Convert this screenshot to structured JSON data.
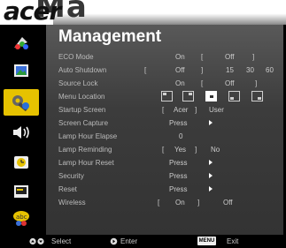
{
  "brand": {
    "logo": "acer",
    "heading_fragment": "Ma"
  },
  "sidebar": {
    "items": [
      {
        "icon": "color-wheel-icon",
        "active": false
      },
      {
        "icon": "image-picture-icon",
        "active": false
      },
      {
        "icon": "settings-management-icon",
        "active": true
      },
      {
        "icon": "speaker-audio-icon",
        "active": false
      },
      {
        "icon": "clock-timer-icon",
        "active": false
      },
      {
        "icon": "screen-display-icon",
        "active": false
      },
      {
        "icon": "language-globe-icon",
        "active": false
      }
    ]
  },
  "panel": {
    "title": "Management",
    "rows": [
      {
        "label": "ECO Mode",
        "values": [
          "On",
          "[",
          "Off",
          "]"
        ]
      },
      {
        "label": "Auto Shutdown",
        "values": [
          "[",
          "Off",
          "]",
          "15",
          "30",
          "60"
        ]
      },
      {
        "label": "Source Lock",
        "values": [
          "On",
          "[",
          "Off",
          "]"
        ]
      },
      {
        "label": "Menu Location"
      },
      {
        "label": "Startup Screen",
        "values": [
          "[",
          "Acer",
          "]",
          "User"
        ]
      },
      {
        "label": "Screen Capture",
        "values": [
          "Press"
        ]
      },
      {
        "label": "Lamp Hour Elapse",
        "values": [
          "0"
        ]
      },
      {
        "label": "Lamp Reminding",
        "values": [
          "[",
          "Yes",
          "]",
          "No"
        ]
      },
      {
        "label": "Lamp Hour Reset",
        "values": [
          "Press"
        ]
      },
      {
        "label": "Security",
        "values": [
          "Press"
        ]
      },
      {
        "label": "Reset",
        "values": [
          "Press"
        ]
      },
      {
        "label": "Wireless",
        "values": [
          "[",
          "On",
          "]",
          "Off"
        ]
      }
    ]
  },
  "footer": {
    "select": "Select",
    "enter": "Enter",
    "menu_key": "MENU",
    "exit": "Exit"
  },
  "colors": {
    "accent": "#e6c200",
    "panel_top": "#595959",
    "panel_bottom": "#333333"
  }
}
